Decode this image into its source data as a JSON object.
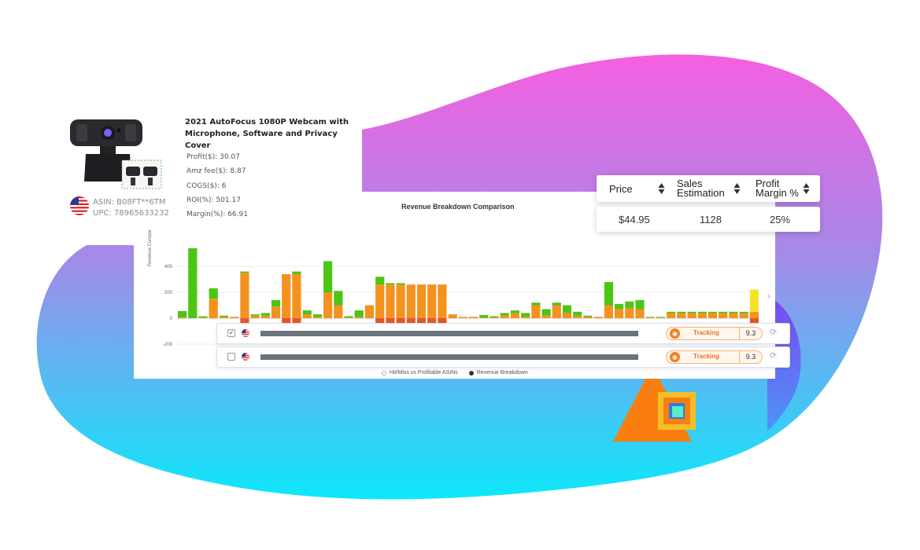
{
  "product": {
    "title": "2021 AutoFocus 1080P Webcam with Microphone, Software and Privacy Cover",
    "metrics": [
      "Profit($): 30.07",
      "Amz fee($): 8.87",
      "COGS($): 6",
      "ROI(%): 501.17",
      "Margin(%): 66.91"
    ],
    "asin": "ASIN: B08FT**6TM",
    "upc": "UPC: 78965633232",
    "marketplace_flag": "us-flag-icon"
  },
  "price_table": {
    "headers": [
      {
        "line1": "Price",
        "line2": ""
      },
      {
        "line1": "Sales",
        "line2": "Estimation"
      },
      {
        "line1": "Profit",
        "line2": "Margin %"
      }
    ],
    "values": [
      "$44.95",
      "1128",
      "25%"
    ]
  },
  "chart": {
    "title": "Revenue Breakdown Comparison",
    "ylabel": "Revenue Component($)",
    "radio_options": [
      {
        "label": "Hit/Miss vs Profitable ASINs",
        "selected": false
      },
      {
        "label": "Revenue Breakdown",
        "selected": true
      }
    ]
  },
  "chart_data": {
    "type": "bar",
    "title": "Revenue Breakdown Comparison",
    "ylabel": "Revenue Component($)",
    "ylim": [
      -250,
      550
    ],
    "yticks": [
      400,
      200,
      0,
      -200
    ],
    "grid": true,
    "colors": {
      "green": "#4cc515",
      "orange": "#f49220",
      "red": "#e5562b",
      "yellow": "#f4e22a"
    },
    "series": [
      {
        "name": "",
        "color": "green",
        "values": [
          50,
          540,
          10,
          80,
          10,
          0,
          10,
          10,
          20,
          50,
          0,
          20,
          30,
          20,
          240,
          110,
          10,
          50,
          0,
          60,
          10,
          10,
          0,
          0,
          0,
          0,
          0,
          0,
          0,
          20,
          10,
          20,
          20,
          30,
          20,
          50,
          20,
          60,
          30,
          10,
          0,
          180,
          40,
          50,
          70,
          5,
          5,
          10,
          10,
          10,
          10,
          10,
          10,
          10,
          10,
          170
        ]
      },
      {
        "name": "",
        "color": "orange",
        "values": [
          5,
          0,
          5,
          150,
          10,
          10,
          350,
          20,
          20,
          90,
          340,
          340,
          30,
          10,
          200,
          100,
          5,
          10,
          100,
          260,
          260,
          260,
          260,
          260,
          260,
          260,
          30,
          10,
          10,
          5,
          5,
          20,
          40,
          10,
          100,
          20,
          100,
          40,
          20,
          10,
          10,
          100,
          70,
          80,
          70,
          5,
          5,
          40,
          40,
          40,
          40,
          40,
          40,
          40,
          40,
          50
        ]
      },
      {
        "name": "",
        "color": "red",
        "values": [
          0,
          0,
          0,
          0,
          0,
          0,
          -50,
          0,
          0,
          0,
          -50,
          -50,
          0,
          0,
          0,
          0,
          0,
          0,
          0,
          -50,
          -50,
          -50,
          -50,
          -50,
          -50,
          -50,
          0,
          0,
          0,
          0,
          0,
          0,
          0,
          0,
          0,
          0,
          0,
          0,
          0,
          0,
          0,
          0,
          0,
          0,
          0,
          0,
          0,
          0,
          0,
          0,
          0,
          0,
          0,
          0,
          0,
          -40
        ]
      }
    ]
  },
  "tracking_rows": [
    {
      "checked": true,
      "status": "Tracking",
      "score": "9.3"
    },
    {
      "checked": false,
      "status": "Tracking",
      "score": "9.3"
    }
  ],
  "decor": {
    "blob_gradient_top": "#f25fe0",
    "blob_gradient_bottom": "#0be6fa",
    "triangle_color": "#f97e0f",
    "square_color": "#f4bf25",
    "inner_square_color": "#58ecc8"
  }
}
